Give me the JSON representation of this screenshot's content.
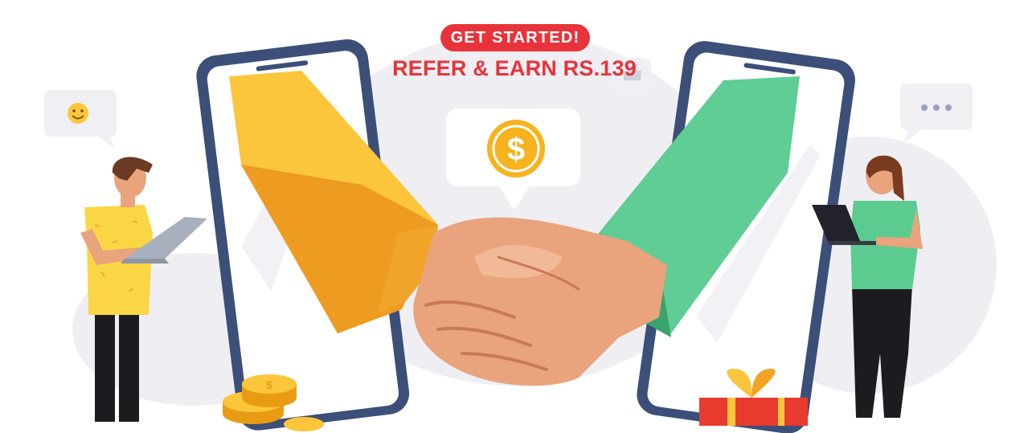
{
  "banner": {
    "cta_label": "GET STARTED!",
    "headline": "REFER & EARN RS.139"
  },
  "colors": {
    "accent": "#e8333a",
    "phone_frame": "#3c4f78",
    "left_sleeve": "#f9c332",
    "right_sleeve": "#5ccb90",
    "coin": "#f7b21e",
    "gift": "#e93a2f"
  },
  "icons": [
    "smile-emoji-icon",
    "dollar-coin-icon",
    "thumbs-up-icon",
    "typing-dots-icon",
    "gift-box-icon"
  ]
}
